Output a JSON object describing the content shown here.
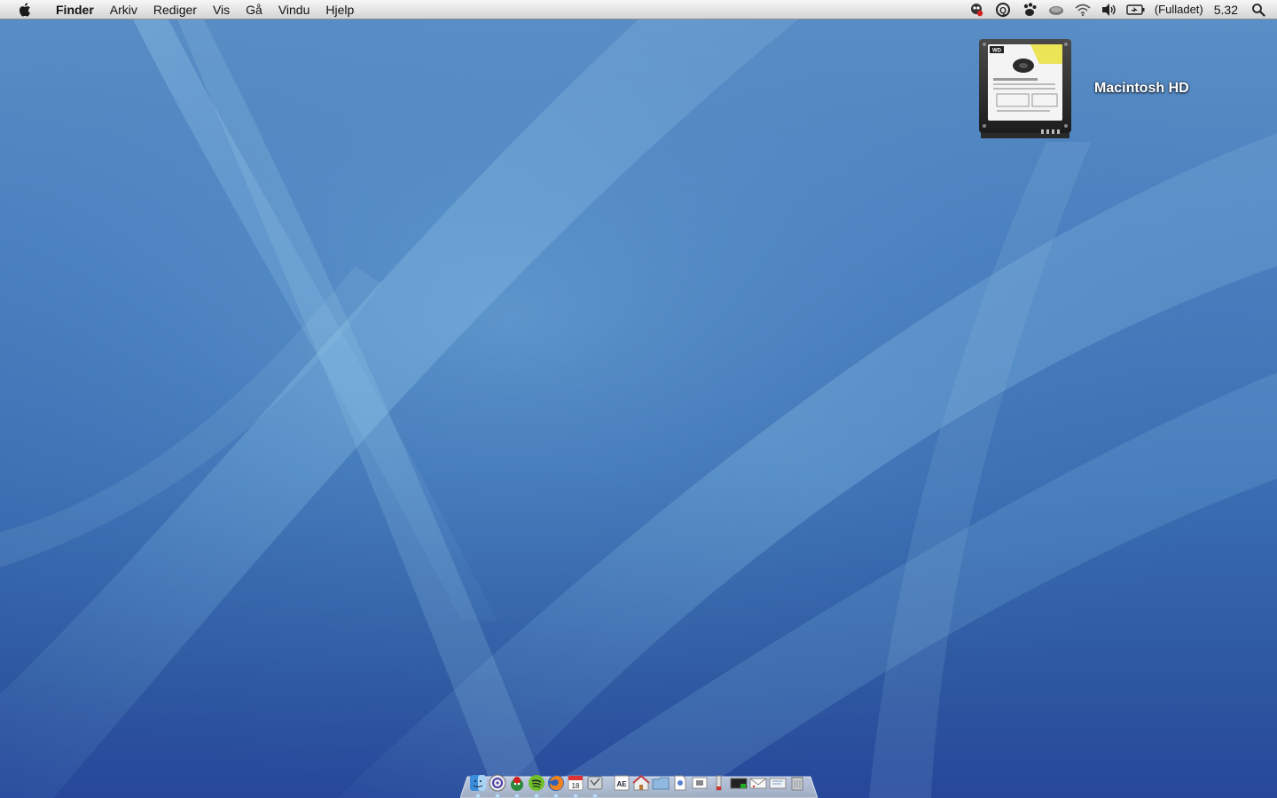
{
  "menubar": {
    "app_name": "Finder",
    "menus": [
      "Arkiv",
      "Rediger",
      "Vis",
      "Gå",
      "Vindu",
      "Hjelp"
    ],
    "status_icons": [
      "adium-icon",
      "quicksilver-icon",
      "growl-icon",
      "time-machine-icon",
      "wifi-icon",
      "volume-icon",
      "battery-icon"
    ],
    "battery_status": "(Fulladet)",
    "clock": "5.32",
    "spotlight_icon": "spotlight-search-icon"
  },
  "desktop": {
    "drive_label": "Macintosh HD",
    "calendar_date": "18"
  },
  "dock": {
    "apps": [
      "finder",
      "itunes",
      "adium",
      "spotify",
      "firefox",
      "ical",
      "system-preferences"
    ],
    "docs": [
      "text-edit",
      "home-folder",
      "applications-folder",
      "document",
      "preview",
      "utilities",
      "terminal",
      "mail",
      "downloads",
      "trash"
    ],
    "separator_text": "AE"
  },
  "colors": {
    "wallpaper_top": "#5b8fc6",
    "wallpaper_bottom": "#27479a",
    "menubar": "#e4e4e4"
  }
}
